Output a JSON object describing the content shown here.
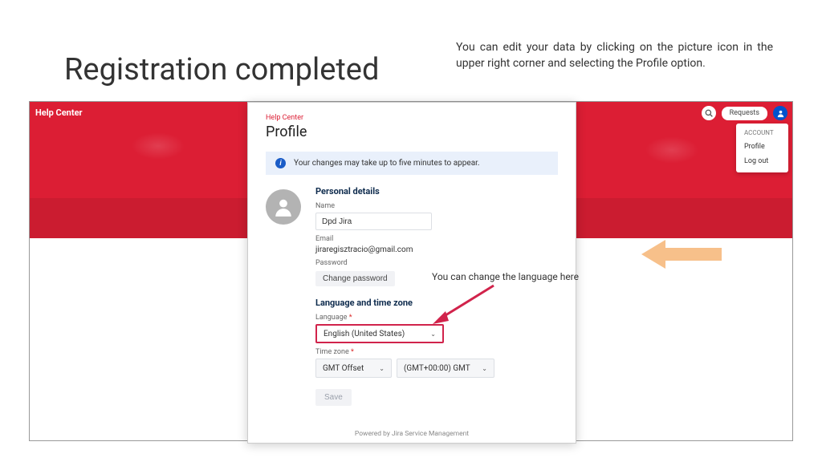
{
  "slide": {
    "title": "Registration completed",
    "description": "You can edit your data by clicking on the picture icon in the upper right corner and selecting the Profile option.",
    "lang_note": "You can change the language here"
  },
  "topbar": {
    "help_center": "Help Center",
    "requests_label": "Requests"
  },
  "dropdown": {
    "header": "ACCOUNT",
    "items": [
      "Profile",
      "Log out"
    ]
  },
  "panel": {
    "crumb": "Help Center",
    "title": "Profile",
    "info_message": "Your changes may take up to five minutes to appear.",
    "personal_heading": "Personal details",
    "lang_heading": "Language and time zone",
    "labels": {
      "name": "Name",
      "email": "Email",
      "password": "Password",
      "language": "Language",
      "timezone": "Time zone"
    },
    "values": {
      "name": "Dpd Jira",
      "email": "jiraregisztracio@gmail.com",
      "change_password": "Change password",
      "language_selected": "English (United States)",
      "tz_offset": "GMT Offset",
      "tz_value": "(GMT+00:00) GMT"
    },
    "save_label": "Save",
    "footer": "Powered by  Jira Service Management"
  }
}
